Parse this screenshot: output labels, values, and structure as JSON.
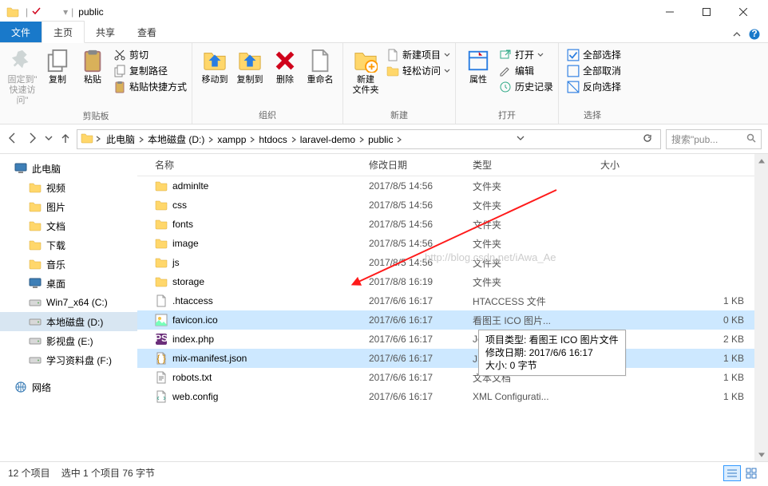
{
  "window": {
    "title": "public"
  },
  "ribbon": {
    "tabs": {
      "file": "文件",
      "home": "主页",
      "share": "共享",
      "view": "查看"
    },
    "groups": {
      "clipboard": {
        "label": "剪贴板",
        "pin": "固定到\"\n快速访问\"",
        "copy": "复制",
        "paste": "粘贴",
        "cut": "剪切",
        "copypath": "复制路径",
        "pasteshortcut": "粘贴快捷方式"
      },
      "organize": {
        "label": "组织",
        "moveto": "移动到",
        "copyto": "复制到",
        "delete": "删除",
        "rename": "重命名"
      },
      "new": {
        "label": "新建",
        "newfolder": "新建\n文件夹",
        "newitem": "新建项目",
        "easyaccess": "轻松访问"
      },
      "open": {
        "label": "打开",
        "properties": "属性",
        "open": "打开",
        "edit": "编辑",
        "history": "历史记录"
      },
      "select": {
        "label": "选择",
        "selectall": "全部选择",
        "selectnone": "全部取消",
        "invert": "反向选择"
      }
    }
  },
  "breadcrumb": [
    "此电脑",
    "本地磁盘 (D:)",
    "xampp",
    "htdocs",
    "laravel-demo",
    "public"
  ],
  "search_placeholder": "搜索\"pub...",
  "columns": {
    "name": "名称",
    "date": "修改日期",
    "type": "类型",
    "size": "大小"
  },
  "sidebar": {
    "this_pc": "此电脑",
    "videos": "视频",
    "pictures": "图片",
    "documents": "文档",
    "downloads": "下载",
    "music": "音乐",
    "desktop": "桌面",
    "drive_c": "Win7_x64 (C:)",
    "drive_d": "本地磁盘 (D:)",
    "drive_e": "影视盘 (E:)",
    "drive_f": "学习资料盘 (F:)",
    "network": "网络"
  },
  "files": [
    {
      "icon": "folder",
      "name": "adminlte",
      "date": "2017/8/5 14:56",
      "type": "文件夹",
      "size": ""
    },
    {
      "icon": "folder",
      "name": "css",
      "date": "2017/8/5 14:56",
      "type": "文件夹",
      "size": ""
    },
    {
      "icon": "folder",
      "name": "fonts",
      "date": "2017/8/5 14:56",
      "type": "文件夹",
      "size": ""
    },
    {
      "icon": "folder",
      "name": "image",
      "date": "2017/8/5 14:56",
      "type": "文件夹",
      "size": ""
    },
    {
      "icon": "folder",
      "name": "js",
      "date": "2017/8/5 14:56",
      "type": "文件夹",
      "size": ""
    },
    {
      "icon": "folder",
      "name": "storage",
      "date": "2017/8/8 16:19",
      "type": "文件夹",
      "size": ""
    },
    {
      "icon": "file",
      "name": ".htaccess",
      "date": "2017/6/6 16:17",
      "type": "HTACCESS 文件",
      "size": "1 KB"
    },
    {
      "icon": "ico",
      "name": "favicon.ico",
      "date": "2017/6/6 16:17",
      "type": "看图王 ICO 图片...",
      "size": "0 KB",
      "selected": true
    },
    {
      "icon": "php",
      "name": "index.php",
      "date": "2017/6/6 16:17",
      "type": "JetBrains PhpSto...",
      "size": "2 KB"
    },
    {
      "icon": "json",
      "name": "mix-manifest.json",
      "date": "2017/6/6 16:17",
      "type": "JSON 文件",
      "size": "1 KB",
      "selected": true
    },
    {
      "icon": "txt",
      "name": "robots.txt",
      "date": "2017/6/6 16:17",
      "type": "文本文档",
      "size": "1 KB"
    },
    {
      "icon": "xml",
      "name": "web.config",
      "date": "2017/6/6 16:17",
      "type": "XML Configurati...",
      "size": "1 KB"
    }
  ],
  "tooltip": {
    "line1": "项目类型: 看图王 ICO 图片文件",
    "line2": "修改日期: 2017/6/6 16:17",
    "line3": "大小: 0 字节"
  },
  "watermark": "http://blog.csdn.net/iAwa_Ae",
  "statusbar": {
    "items": "12 个项目",
    "selected": "选中 1 个项目 76 字节"
  }
}
